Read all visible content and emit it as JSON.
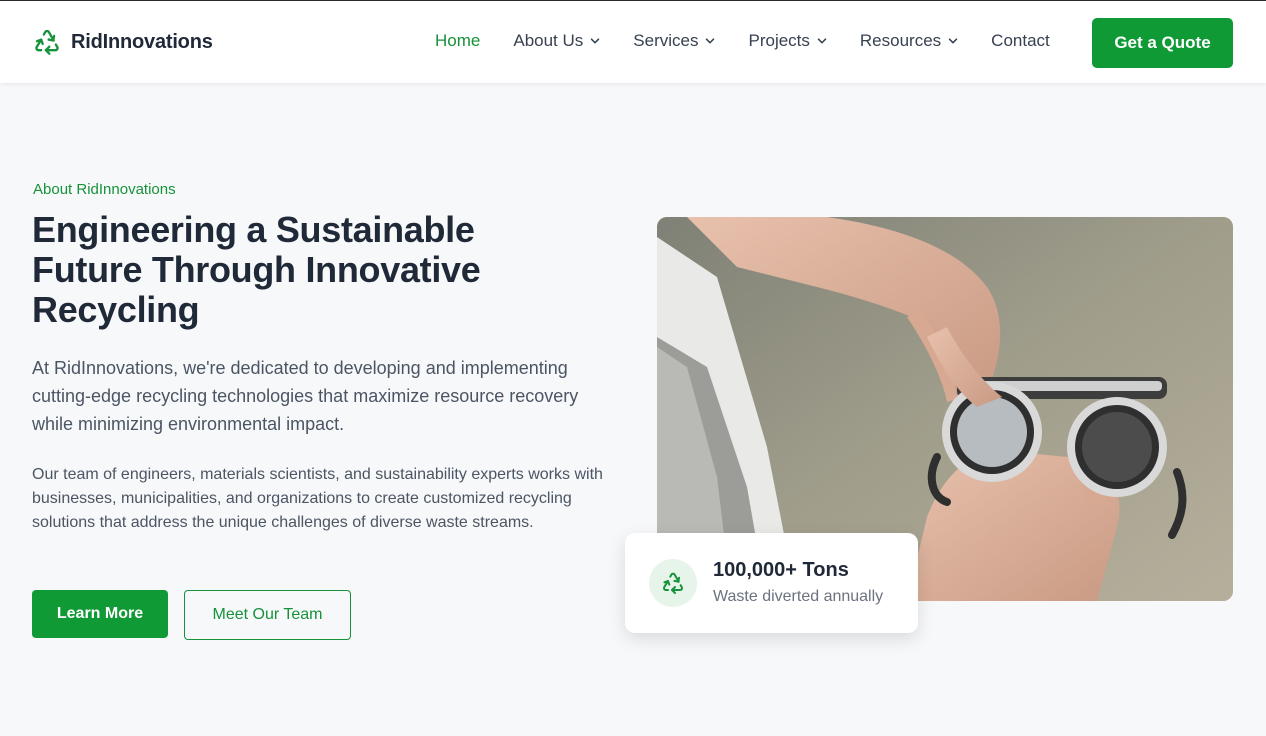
{
  "brand": {
    "name": "RidInnovations",
    "logo_icon": "recycle-icon",
    "accent_color": "#0f9a35"
  },
  "nav": {
    "items": [
      {
        "label": "Home",
        "active": true,
        "has_dropdown": false
      },
      {
        "label": "About Us",
        "active": false,
        "has_dropdown": true
      },
      {
        "label": "Services",
        "active": false,
        "has_dropdown": true
      },
      {
        "label": "Projects",
        "active": false,
        "has_dropdown": true
      },
      {
        "label": "Resources",
        "active": false,
        "has_dropdown": true
      },
      {
        "label": "Contact",
        "active": false,
        "has_dropdown": false
      }
    ],
    "cta_label": "Get a Quote"
  },
  "hero": {
    "eyebrow": "About RidInnovations",
    "title": "Engineering a Sustainable Future Through Innovative Recycling",
    "lead": "At RidInnovations, we're dedicated to developing and implementing cutting-edge recycling technologies that maximize resource recovery while minimizing environmental impact.",
    "body": "Our team of engineers, materials scientists, and sustainability experts works with businesses, municipalities, and organizations to create customized recycling solutions that address the unique challenges of diverse waste streams.",
    "primary_button": "Learn More",
    "secondary_button": "Meet Our Team"
  },
  "stat": {
    "icon": "recycle-icon",
    "value": "100,000+ Tons",
    "label": "Waste diverted annually"
  }
}
